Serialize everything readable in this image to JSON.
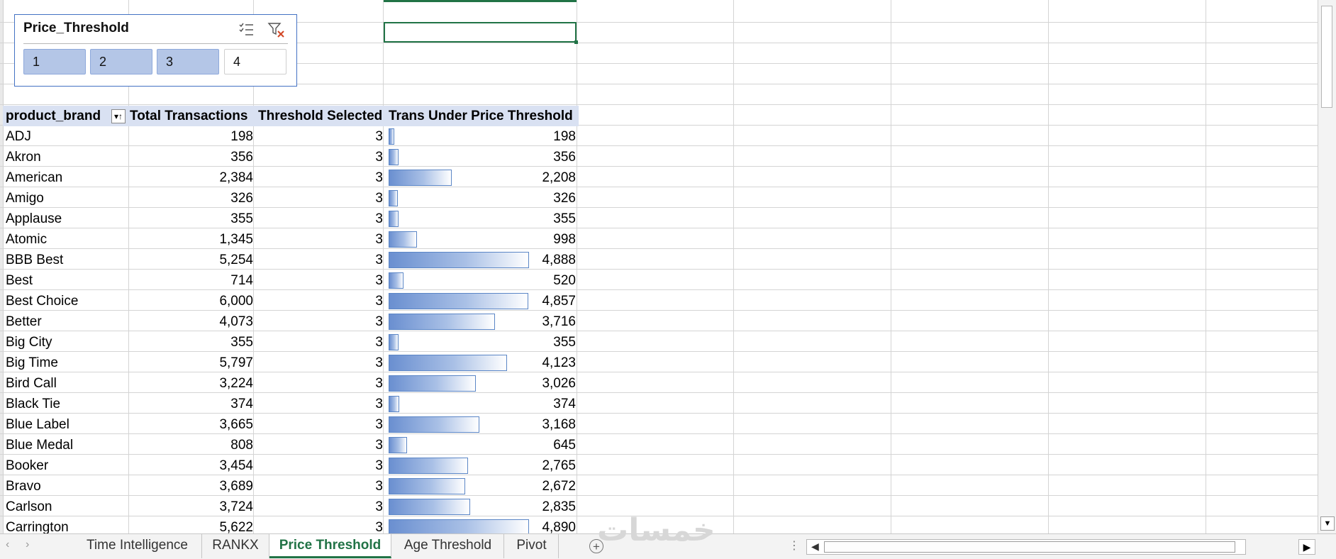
{
  "slicer": {
    "title": "Price_Threshold",
    "icons": [
      "multi-select-icon",
      "clear-filter-icon"
    ],
    "options": [
      {
        "label": "1",
        "selected": true
      },
      {
        "label": "2",
        "selected": true
      },
      {
        "label": "3",
        "selected": true
      },
      {
        "label": "4",
        "selected": false
      }
    ]
  },
  "pivot": {
    "headers": [
      "product_brand",
      "Total Transactions",
      "Threshold Selected",
      "Trans Under Price Threshold"
    ],
    "databar_max": 4890,
    "rows": [
      {
        "brand": "ADJ",
        "total": "198",
        "threshold": "3",
        "under": "198",
        "under_value": 198
      },
      {
        "brand": "Akron",
        "total": "356",
        "threshold": "3",
        "under": "356",
        "under_value": 356
      },
      {
        "brand": "American",
        "total": "2,384",
        "threshold": "3",
        "under": "2,208",
        "under_value": 2208
      },
      {
        "brand": "Amigo",
        "total": "326",
        "threshold": "3",
        "under": "326",
        "under_value": 326
      },
      {
        "brand": "Applause",
        "total": "355",
        "threshold": "3",
        "under": "355",
        "under_value": 355
      },
      {
        "brand": "Atomic",
        "total": "1,345",
        "threshold": "3",
        "under": "998",
        "under_value": 998
      },
      {
        "brand": "BBB Best",
        "total": "5,254",
        "threshold": "3",
        "under": "4,888",
        "under_value": 4888
      },
      {
        "brand": "Best",
        "total": "714",
        "threshold": "3",
        "under": "520",
        "under_value": 520
      },
      {
        "brand": "Best Choice",
        "total": "6,000",
        "threshold": "3",
        "under": "4,857",
        "under_value": 4857
      },
      {
        "brand": "Better",
        "total": "4,073",
        "threshold": "3",
        "under": "3,716",
        "under_value": 3716
      },
      {
        "brand": "Big City",
        "total": "355",
        "threshold": "3",
        "under": "355",
        "under_value": 355
      },
      {
        "brand": "Big Time",
        "total": "5,797",
        "threshold": "3",
        "under": "4,123",
        "under_value": 4123
      },
      {
        "brand": "Bird Call",
        "total": "3,224",
        "threshold": "3",
        "under": "3,026",
        "under_value": 3026
      },
      {
        "brand": "Black Tie",
        "total": "374",
        "threshold": "3",
        "under": "374",
        "under_value": 374
      },
      {
        "brand": "Blue Label",
        "total": "3,665",
        "threshold": "3",
        "under": "3,168",
        "under_value": 3168
      },
      {
        "brand": "Blue Medal",
        "total": "808",
        "threshold": "3",
        "under": "645",
        "under_value": 645
      },
      {
        "brand": "Booker",
        "total": "3,454",
        "threshold": "3",
        "under": "2,765",
        "under_value": 2765
      },
      {
        "brand": "Bravo",
        "total": "3,689",
        "threshold": "3",
        "under": "2,672",
        "under_value": 2672
      },
      {
        "brand": "Carlson",
        "total": "3,724",
        "threshold": "3",
        "under": "2,835",
        "under_value": 2835
      },
      {
        "brand": "Carrington",
        "total": "5,622",
        "threshold": "3",
        "under": "4,890",
        "under_value": 4890
      }
    ]
  },
  "tabs": {
    "items": [
      {
        "label": "Time Intelligence",
        "active": false
      },
      {
        "label": "RANKX",
        "active": false
      },
      {
        "label": "Price Threshold",
        "active": true
      },
      {
        "label": "Age Threshold",
        "active": false
      },
      {
        "label": "Pivot",
        "active": false
      }
    ],
    "add_label": "+"
  },
  "watermark": "خمسات",
  "colors": {
    "excel_green": "#217346",
    "slicer_selected": "#b4c6e7",
    "header_fill": "#d9e1f2",
    "databar": "#6a8fd0"
  }
}
